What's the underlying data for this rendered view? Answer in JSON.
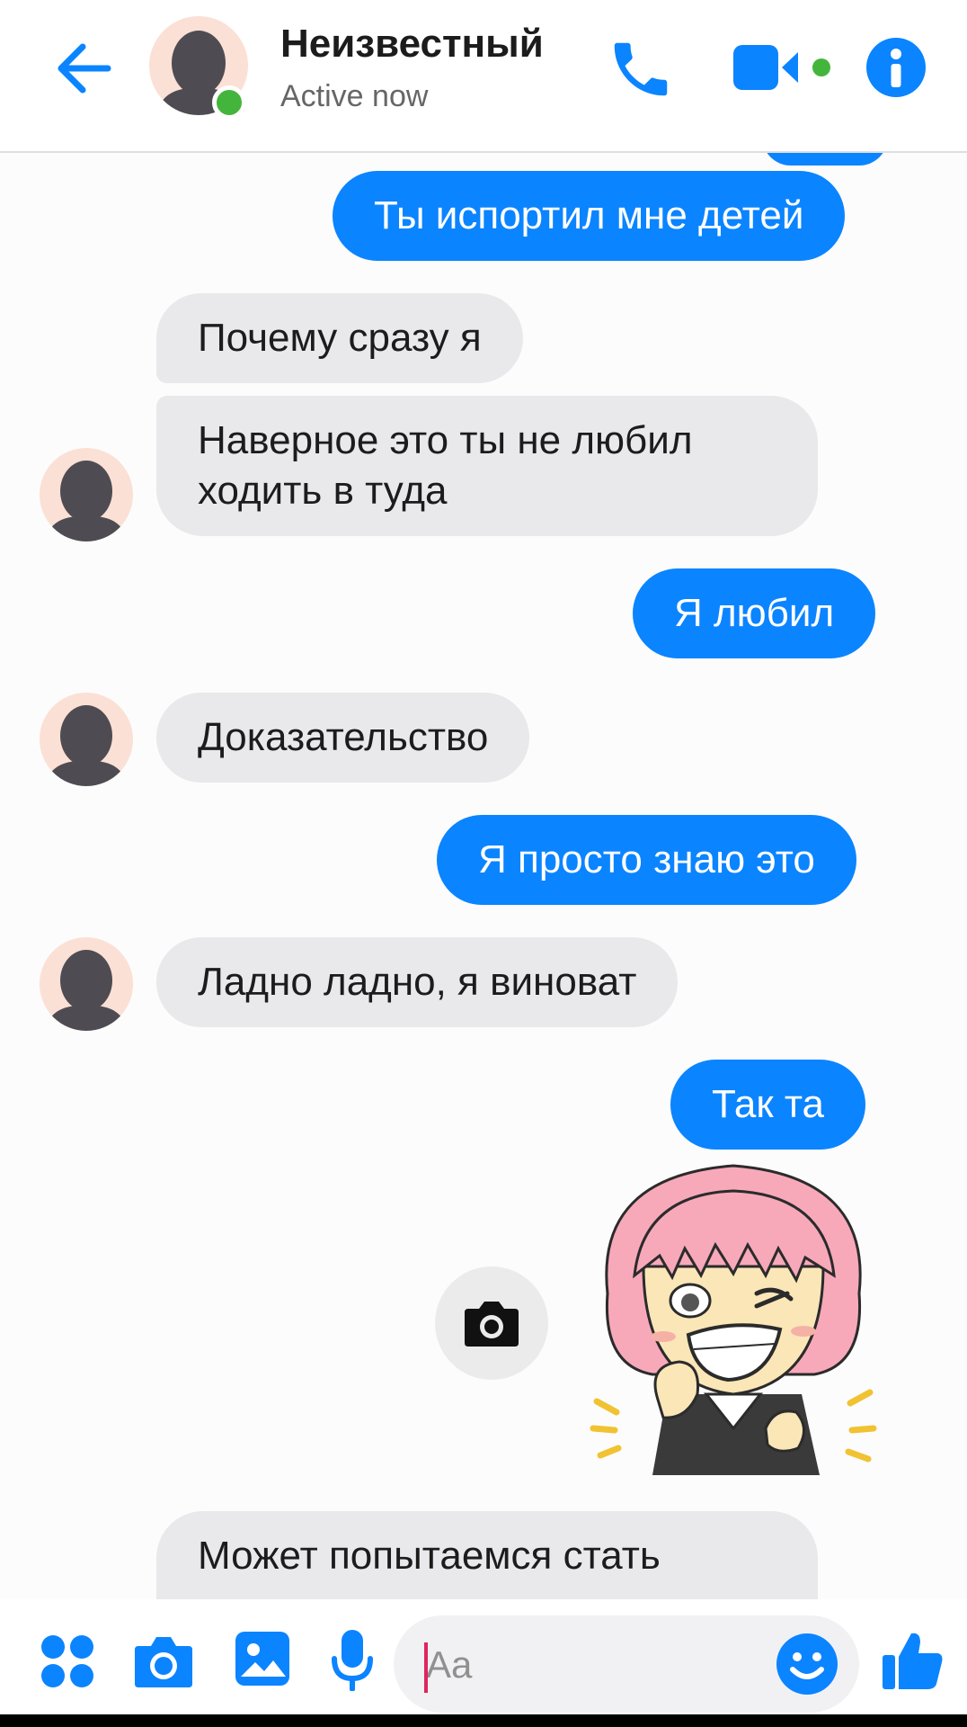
{
  "header": {
    "contact_name": "Неизвестный",
    "status": "Active now",
    "colors": {
      "accent": "#0b84ff",
      "online": "#44b53c"
    }
  },
  "messages": [
    {
      "id": "m1",
      "from": "me",
      "text": "Ты испортил мне детей"
    },
    {
      "id": "m2",
      "from": "them",
      "text": "Почему сразу я"
    },
    {
      "id": "m3",
      "from": "them",
      "text": "Наверное это ты не любил\nходить в туда"
    },
    {
      "id": "m4",
      "from": "me",
      "text": "Я любил"
    },
    {
      "id": "m5",
      "from": "them",
      "text": "Доказательство"
    },
    {
      "id": "m6",
      "from": "me",
      "text": "Я просто знаю это"
    },
    {
      "id": "m7",
      "from": "them",
      "text": "Ладно ладно, я виноват"
    },
    {
      "id": "m8",
      "from": "me",
      "text": "Так та"
    },
    {
      "id": "m9",
      "from": "me",
      "type": "sticker",
      "icon": "pink-hair-girl-wink-sticker"
    },
    {
      "id": "m10",
      "from": "them",
      "text": "Может попытаемся стать"
    }
  ],
  "composer": {
    "placeholder": "Aa",
    "icons": [
      "apps-icon",
      "camera-icon",
      "gallery-icon",
      "microphone-icon",
      "emoji-icon",
      "thumbs-up-icon"
    ]
  }
}
